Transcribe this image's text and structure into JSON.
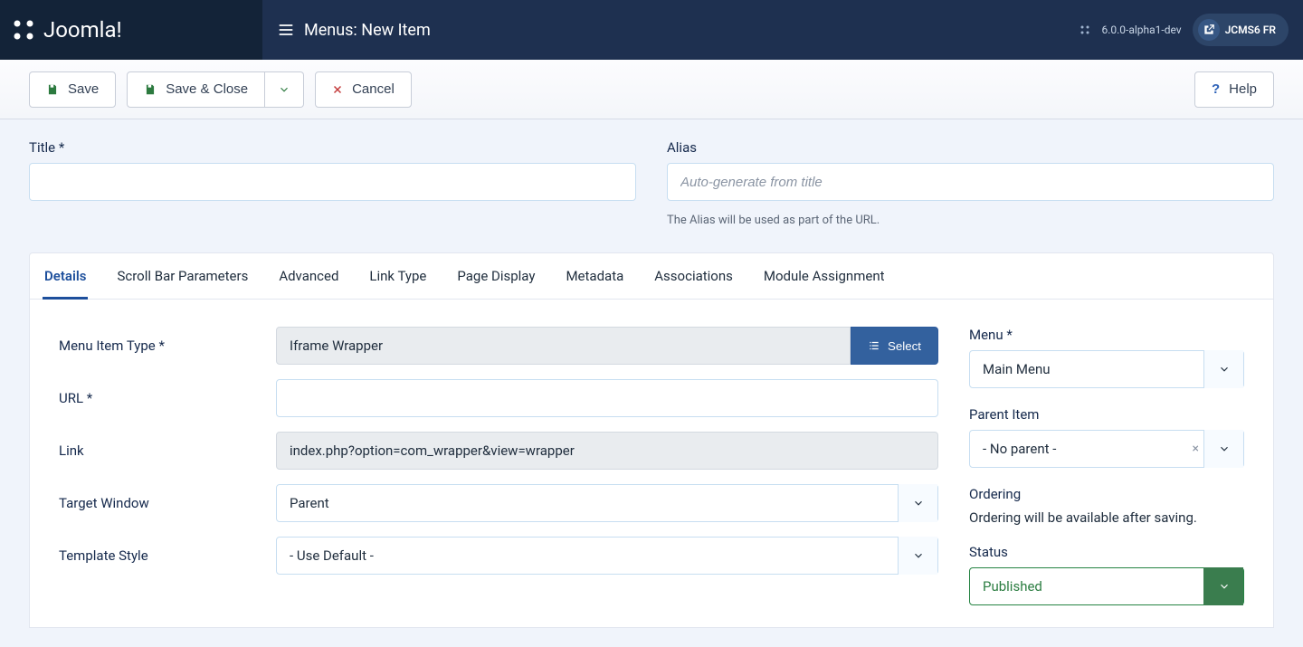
{
  "header": {
    "brand": "Joomla!",
    "pageTitleShort": "New Item",
    "pageTitle": "Menus: New Item",
    "version": "6.0.0-alpha1-dev",
    "siteName": "JCMS6 FR"
  },
  "toolbar": {
    "save": "Save",
    "saveClose": "Save & Close",
    "cancel": "Cancel",
    "help": "Help"
  },
  "formHead": {
    "titleLabel": "Title *",
    "titleValue": "",
    "aliasLabel": "Alias",
    "aliasPlaceholder": "Auto-generate from title",
    "aliasHint": "The Alias will be used as part of the URL."
  },
  "tabs": [
    "Details",
    "Scroll Bar Parameters",
    "Advanced",
    "Link Type",
    "Page Display",
    "Metadata",
    "Associations",
    "Module Assignment"
  ],
  "activeTab": 0,
  "details": {
    "menuItemTypeLabel": "Menu Item Type *",
    "menuItemTypeValue": "Iframe Wrapper",
    "selectButton": "Select",
    "urlLabel": "URL *",
    "urlValue": "",
    "linkLabel": "Link",
    "linkValue": "index.php?option=com_wrapper&view=wrapper",
    "targetWindowLabel": "Target Window",
    "targetWindowValue": "Parent",
    "templateStyleLabel": "Template Style",
    "templateStyleValue": "- Use Default -"
  },
  "aside": {
    "menuLabel": "Menu *",
    "menuValue": "Main Menu",
    "parentLabel": "Parent Item",
    "parentValue": "- No parent -",
    "orderingLabel": "Ordering",
    "orderingHint": "Ordering will be available after saving.",
    "statusLabel": "Status",
    "statusValue": "Published"
  }
}
